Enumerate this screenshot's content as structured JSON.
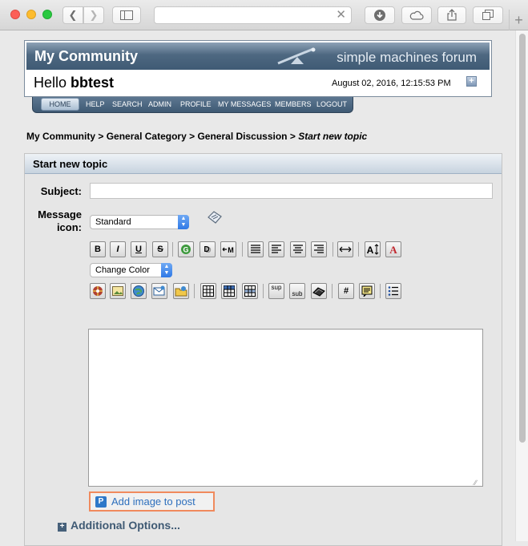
{
  "forum": {
    "title": "My Community",
    "logo_text": "simple machines forum",
    "greeting": "Hello",
    "username": "bbtest",
    "datetime": "August 02, 2016, 12:15:53 PM",
    "toggle_symbol": "+"
  },
  "nav": {
    "items": [
      "HOME",
      "HELP",
      "SEARCH",
      "ADMIN",
      "PROFILE",
      "MY MESSAGES",
      "MEMBERS",
      "LOGOUT"
    ],
    "active": "HOME"
  },
  "breadcrumb": {
    "items": [
      "My Community",
      "General Category",
      "General Discussion"
    ],
    "current": "Start new topic",
    "separator": ">"
  },
  "form": {
    "title": "Start new topic",
    "subject_label": "Subject:",
    "subject_value": "",
    "message_icon_label_line1": "Message",
    "message_icon_label_line2": "icon:",
    "message_icon_value": "Standard",
    "color_select_value": "Change Color",
    "message_body": ""
  },
  "toolbar": {
    "bold": "B",
    "italic": "I",
    "underline": "U",
    "strike": "S",
    "sup": "sup",
    "sub": "sub",
    "hash": "#"
  },
  "add_image": {
    "icon_letter": "P",
    "label": "Add image to post"
  },
  "additional_options": {
    "label": "Additional Options...",
    "expand_symbol": "+"
  },
  "colors": {
    "header_blue": "#3f5a74",
    "link_blue": "#2d6fbd",
    "highlight_orange": "#f08a5d"
  }
}
